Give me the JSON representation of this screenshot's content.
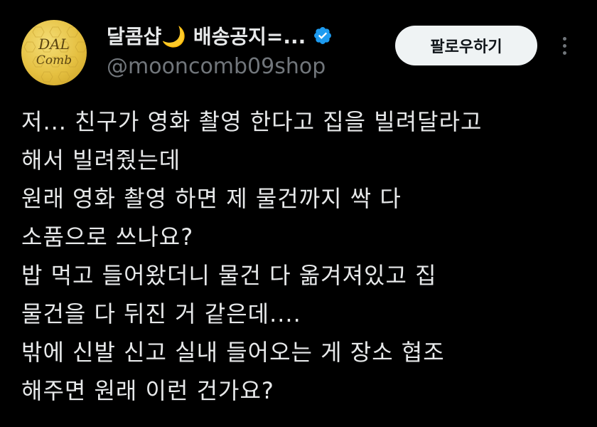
{
  "colors": {
    "background": "#000000",
    "primary_text": "#e7e9ea",
    "secondary_text": "#71767b",
    "verified": "#1d9bf0",
    "follow_button_bg": "#eff3f4",
    "avatar_gold": "#e5c041"
  },
  "author": {
    "avatar_text_line1": "DAL",
    "avatar_text_line2": "Comb",
    "display_name": "달콤샵🌙 배송공지=...",
    "verified_icon": "verified-badge-icon",
    "handle": "@mooncomb09shop"
  },
  "actions": {
    "follow_label": "팔로우하기",
    "more_icon": "more-vertical-icon"
  },
  "tweet": {
    "lines": [
      "저... 친구가 영화 촬영 한다고 집을 빌려달라고",
      "해서 빌려줬는데",
      "원래 영화 촬영 하면 제 물건까지 싹 다",
      "소품으로 쓰나요?",
      "밥 먹고 들어왔더니 물건 다 옮겨져있고 집",
      "물건을 다 뒤진 거 같은데....",
      "밖에 신발 신고 실내 들어오는 게 장소 협조",
      "해주면 원래 이런 건가요?"
    ]
  }
}
